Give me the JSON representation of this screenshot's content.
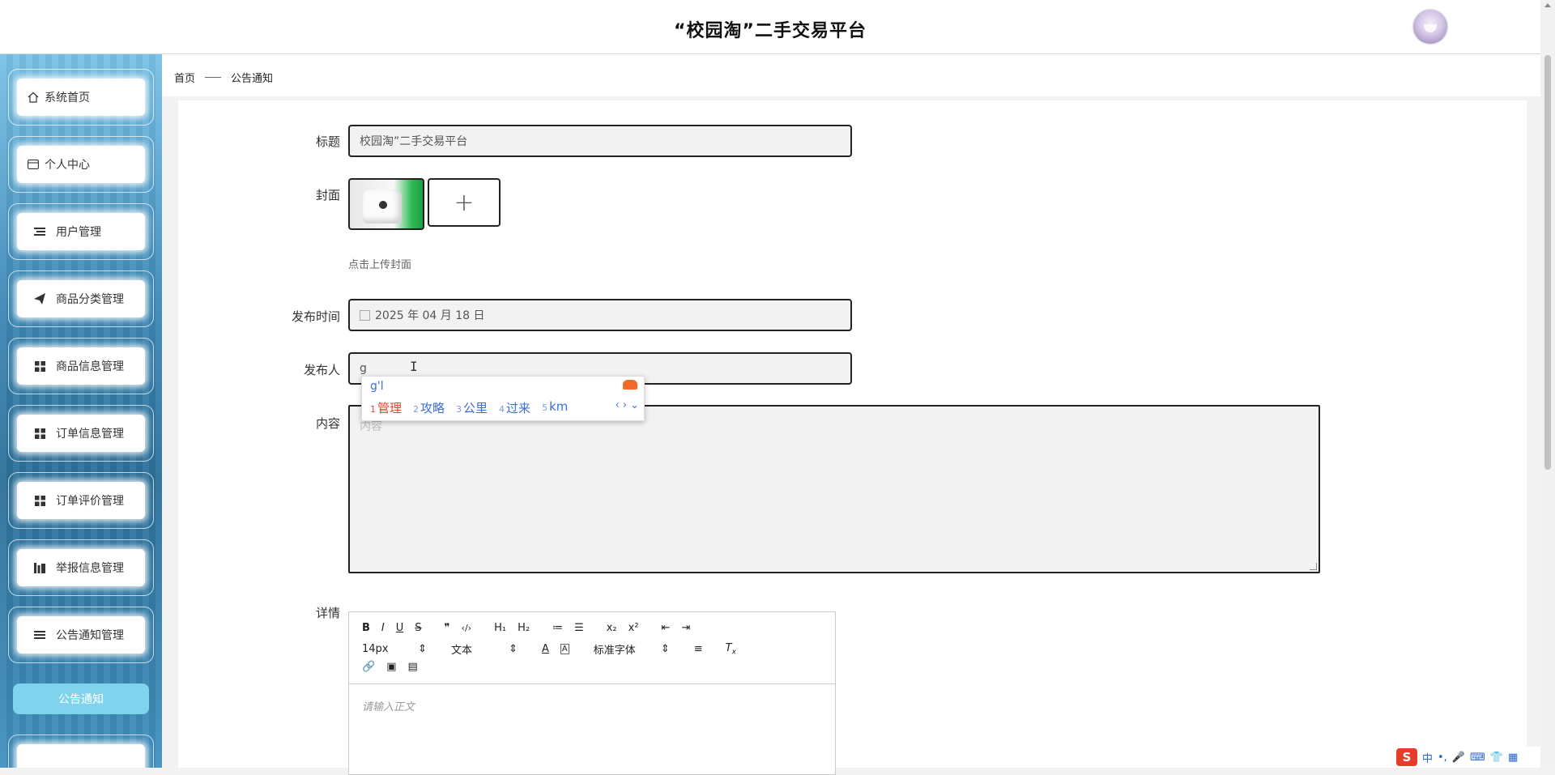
{
  "header": {
    "title": "“校园淘”二手交易平台"
  },
  "sidebar": {
    "items": [
      {
        "label": "系统首页",
        "icon": "home-icon"
      },
      {
        "label": "个人中心",
        "icon": "card-icon"
      },
      {
        "label": "用户管理",
        "icon": "list-icon"
      },
      {
        "label": "商品分类管理",
        "icon": "send-icon"
      },
      {
        "label": "商品信息管理",
        "icon": "grid-icon"
      },
      {
        "label": "订单信息管理",
        "icon": "grid-icon"
      },
      {
        "label": "订单评价管理",
        "icon": "grid-icon"
      },
      {
        "label": "举报信息管理",
        "icon": "chart-icon"
      },
      {
        "label": "公告通知管理",
        "icon": "menu-icon"
      }
    ],
    "submenu_active": "公告通知"
  },
  "breadcrumb": {
    "home": "首页",
    "current": "公告通知"
  },
  "form": {
    "title_label": "标题",
    "title_value": "校园淘”二手交易平台",
    "cover_label": "封面",
    "cover_add": "+",
    "cover_hint": "点击上传封面",
    "publish_time_label": "发布时间",
    "publish_time_value": "2025 年 04 月 18 日",
    "publisher_label": "发布人",
    "publisher_value": "g",
    "content_label": "内容",
    "content_placeholder": "内容",
    "details_label": "详情"
  },
  "ime": {
    "input": "g'l",
    "candidates": [
      {
        "num": "1",
        "text": "管理"
      },
      {
        "num": "2",
        "text": "攻略"
      },
      {
        "num": "3",
        "text": "公里"
      },
      {
        "num": "4",
        "text": "过来"
      },
      {
        "num": "5",
        "text": "km"
      }
    ],
    "nav": "‹ › ⌄"
  },
  "editor": {
    "toolbar_row1": [
      "B",
      "I",
      "U",
      "S",
      "❞",
      "‹/›",
      "H₁",
      "H₂",
      "≔",
      "☰",
      "x₂",
      "x²",
      "⇤",
      "⇥"
    ],
    "font_size": "14px",
    "text_style": "文本",
    "font_family": "标准字体",
    "placeholder": "请输入正文"
  },
  "tray": {
    "logo": "S",
    "items": [
      "中",
      "•,",
      "🎤",
      "⌨",
      "👕",
      "▦"
    ]
  },
  "colors": {
    "sidebar_top": "#79c1e6",
    "sidebar_bottom": "#2c6f98",
    "submenu": "#7fd3ec",
    "ime_highlight": "#e5432f",
    "ime_text": "#3a6fd8"
  }
}
